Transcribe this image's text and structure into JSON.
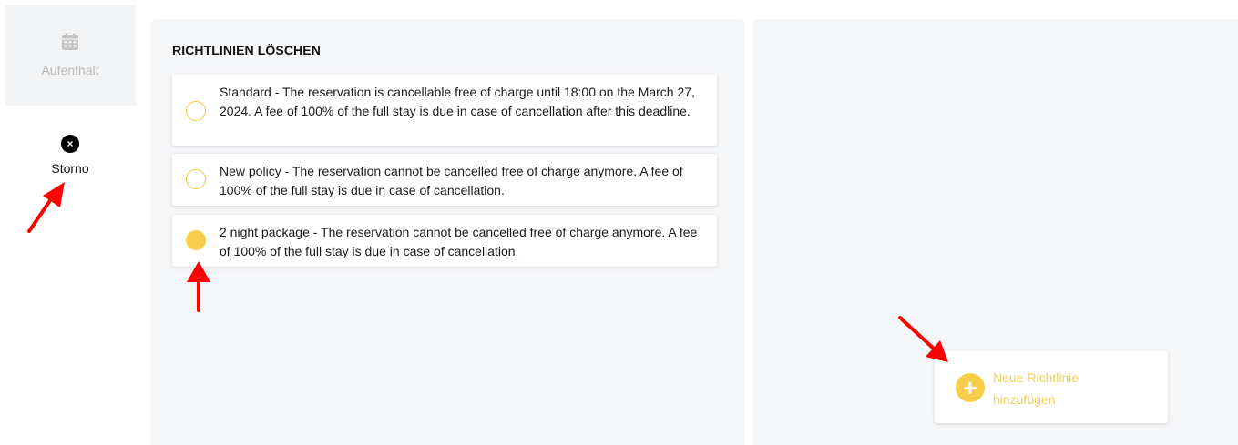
{
  "sidebar": {
    "items": [
      {
        "label": "Aufenthalt",
        "icon": "calendar-icon"
      },
      {
        "label": "Storno",
        "icon": "close-circle-icon",
        "icon_glyph": "×"
      }
    ]
  },
  "main": {
    "title": "RICHTLINIEN LÖSCHEN",
    "policies": [
      {
        "text": "Standard - The reservation is cancellable free of charge until 18:00 on the March 27, 2024. A fee of 100% of the full stay is due in case of cancellation after this deadline.",
        "selected": false
      },
      {
        "text": "New policy - The reservation cannot be cancelled free of charge anymore. A fee of 100% of the full stay is due in case of cancellation.",
        "selected": false
      },
      {
        "text": "2 night package - The reservation cannot be cancelled free of charge anymore. A fee of 100% of the full stay is due in case of cancellation.",
        "selected": true
      }
    ]
  },
  "right": {
    "add_button": {
      "label": "Neue Richtlinie hinzufügen",
      "icon": "plus-circle-icon",
      "icon_glyph": "+"
    }
  },
  "colors": {
    "accent": "#f7cd4a",
    "panel_bg": "#f5f6f8",
    "annotation_arrow": "#ff0000"
  }
}
